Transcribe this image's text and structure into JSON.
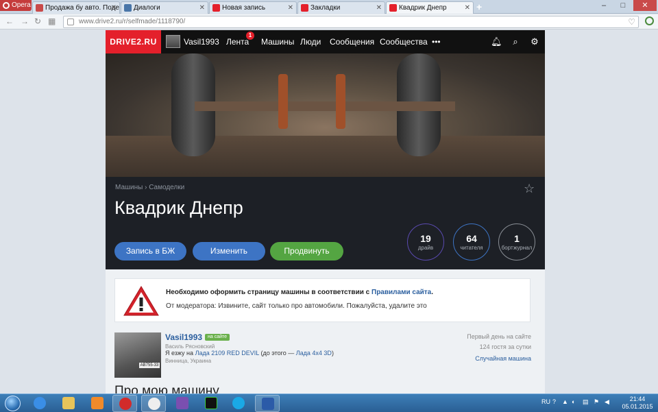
{
  "browser": {
    "menu_label": "Opera",
    "tabs": [
      {
        "label": "Продажа бу авто. Подер",
        "active": false,
        "favicon_color": "#c94a4a"
      },
      {
        "label": "Диалоги",
        "active": false,
        "favicon_color": "#4a76a8"
      },
      {
        "label": "Новая запись",
        "active": false,
        "favicon_color": "#e4202b"
      },
      {
        "label": "Закладки",
        "active": false,
        "favicon_color": "#e4202b"
      },
      {
        "label": "Квадрик Днепр",
        "active": true,
        "favicon_color": "#e4202b"
      }
    ],
    "tab_close": "✕",
    "new_tab": "+",
    "url": "www.drive2.ru/r/selfmade/1118790/",
    "window_controls": [
      "–",
      "□",
      "✕"
    ]
  },
  "site": {
    "logo": "DRIVE2.RU",
    "user": "Vasil1993",
    "nav": [
      "Лента",
      "Машины",
      "Люди",
      "Сообщения",
      "Сообщества",
      "•••"
    ],
    "feed_badge": "1",
    "accent": "#e4202b"
  },
  "car": {
    "breadcrumb": "Машины › Самоделки",
    "title": "Квадрик Днепр",
    "buttons": {
      "logbook": "Запись в БЖ",
      "edit": "Изменить",
      "promote": "Продвинуть"
    },
    "stats": [
      {
        "num": "19",
        "label": "драйв",
        "color": "#5a4ab0"
      },
      {
        "num": "64",
        "label": "читателя",
        "color": "#3d74c4"
      },
      {
        "num": "1",
        "label": "бортжурнал",
        "color": "#8a8f96"
      }
    ]
  },
  "notice": {
    "text": "Необходимо оформить страницу машины в соответствии с",
    "link": "Правилами сайта",
    "period": ".",
    "moderator": "От модератора: Извините, сайт только про автомобили. Пожалуйста, удалите это"
  },
  "owner": {
    "name": "Vasil1993",
    "online": "на сайте",
    "real_name": "Василь Рясновский",
    "drive_prefix": "Я езжу на",
    "car": "Лада 2109 RED DEVIL",
    "before": "(до этого —",
    "prev_car": "Лада 4x4 3D",
    "close": ")",
    "city": "Винница, Украина",
    "plate": "АВ755-33",
    "first_day": "Первый день на сайте",
    "guests": "124 гостя за сутки",
    "random": "Случайная машина"
  },
  "section_title": "Про мою машину",
  "taskbar": {
    "lang": "RU",
    "time": "21:44",
    "date": "05.01.2015"
  }
}
